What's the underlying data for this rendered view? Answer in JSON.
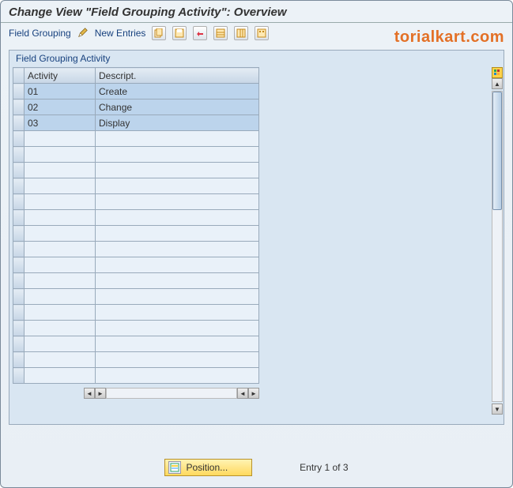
{
  "header": {
    "title": "Change View \"Field Grouping Activity\": Overview"
  },
  "toolbar": {
    "field_grouping": "Field Grouping",
    "new_entries": "New Entries"
  },
  "watermark": "torialkart.com",
  "panel": {
    "title": "Field Grouping Activity"
  },
  "table": {
    "columns": {
      "activity": "Activity",
      "description": "Descript."
    },
    "rows": [
      {
        "activity": "01",
        "description": "Create"
      },
      {
        "activity": "02",
        "description": "Change"
      },
      {
        "activity": "03",
        "description": "Display"
      }
    ],
    "empty_rows": 16
  },
  "footer": {
    "position_button": "Position...",
    "entry_text": "Entry 1 of 3"
  }
}
